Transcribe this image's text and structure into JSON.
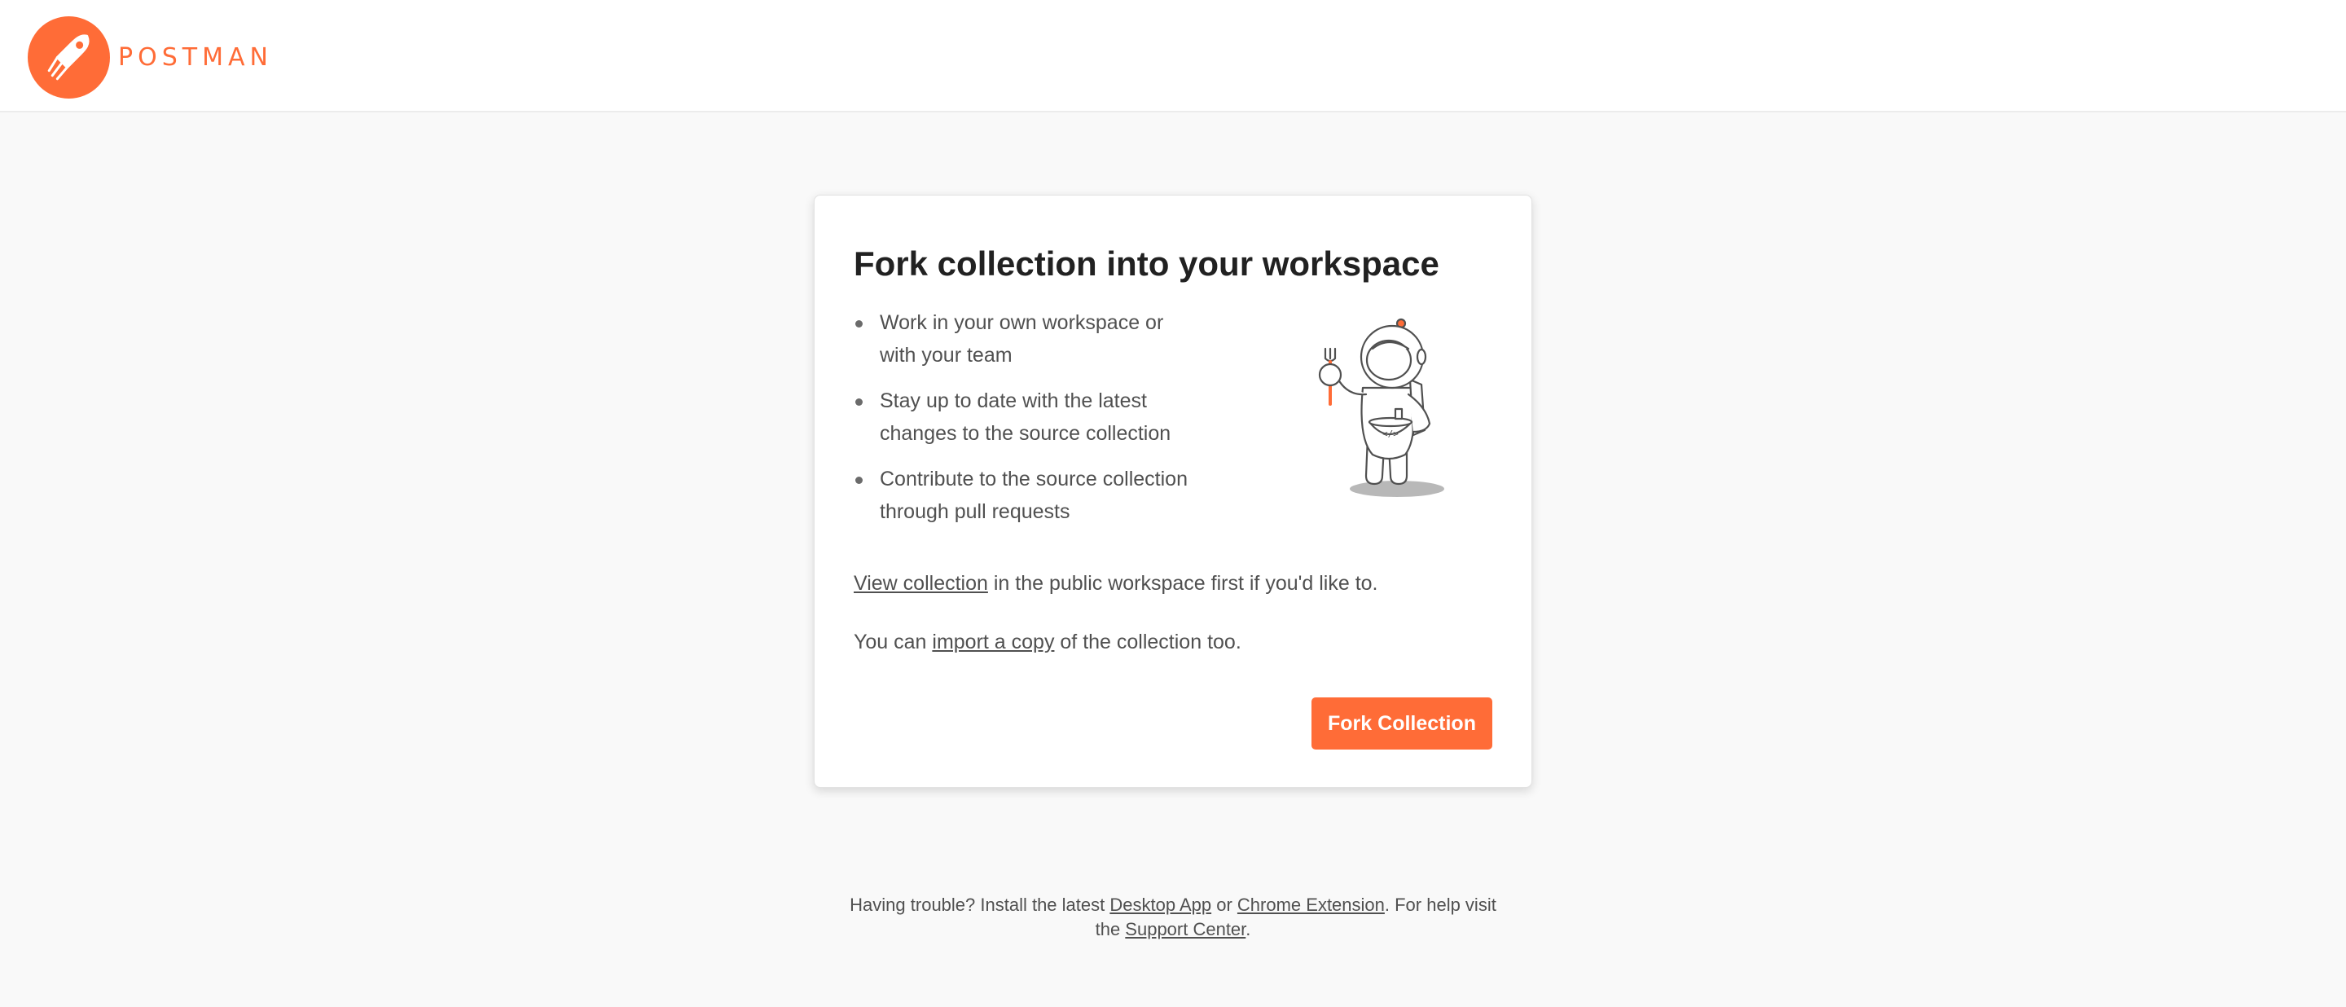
{
  "header": {
    "logo_text": "POSTMAN",
    "logo_icon": "postman-rocket-icon"
  },
  "card": {
    "title": "Fork collection into your workspace",
    "bullets": [
      {
        "line1": "Work in your own workspace or",
        "line2": "with your team"
      },
      {
        "line1": "Stay up to date with the latest",
        "line2": "changes to the source collection"
      },
      {
        "line1": "Contribute to the source collection",
        "line2": "through pull requests"
      }
    ],
    "illustration_icon": "astronaut-illustration",
    "view_line": {
      "link": "View collection",
      "text": " in the public workspace first if you'd like to."
    },
    "import_line": {
      "prefix": "You can ",
      "link": "import a copy",
      "suffix": " of the collection too."
    },
    "fork_button": "Fork Collection"
  },
  "footer": {
    "prefix": "Having trouble? Install the latest ",
    "desktop_link": "Desktop App",
    "or": " or ",
    "chrome_link": "Chrome Extension",
    "mid": ". For help visit the ",
    "support_link": "Support Center",
    "end": "."
  },
  "colors": {
    "brand": "#ff6c37",
    "background": "#f9f9f9",
    "card": "#ffffff",
    "title": "#212121",
    "text": "#505050"
  }
}
